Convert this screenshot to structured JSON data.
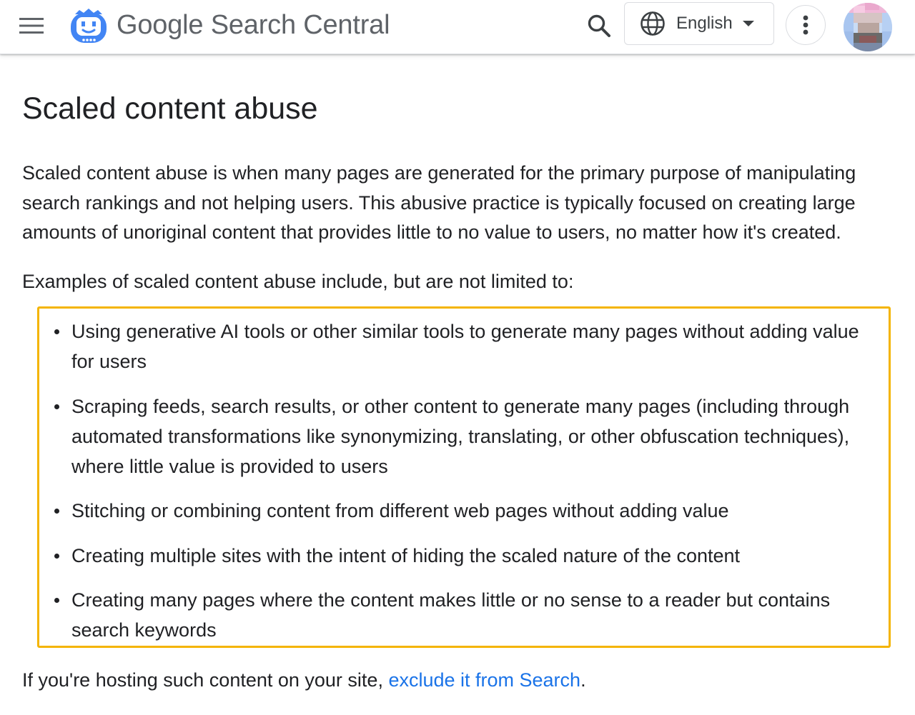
{
  "header": {
    "brand_google": "Google",
    "brand_rest": " Search Central",
    "language_label": "English",
    "icons": {
      "menu": "hamburger-menu-icon",
      "logo": "search-central-robot-logo",
      "search": "search-icon",
      "language": "globe-icon",
      "caret": "caret-down-icon",
      "more": "more-vert-icon",
      "avatar": "user-avatar"
    },
    "colors": {
      "logo_blue": "#4285f4",
      "brand_text": "#5f6368"
    }
  },
  "article": {
    "title": "Scaled content abuse",
    "intro": "Scaled content abuse is when many pages are generated for the primary purpose of manipulating search rankings and not helping users. This abusive practice is typically focused on creating large amounts of unoriginal content that provides little to no value to users, no matter how it's created.",
    "examples_intro": "Examples of scaled content abuse include, but are not limited to:",
    "examples": [
      "Using generative AI tools or other similar tools to generate many pages without adding value for users",
      "Scraping feeds, search results, or other content to generate many pages (including through automated transformations like synonymizing, translating, or other obfuscation techniques), where little value is provided to users",
      "Stitching or combining content from different web pages without adding value",
      "Creating multiple sites with the intent of hiding the scaled nature of the content",
      "Creating many pages where the content makes little or no sense to a reader but contains search keywords"
    ],
    "footer_prefix": "If you're hosting such content on your site, ",
    "footer_link": "exclude it from Search",
    "footer_suffix": ".",
    "colors": {
      "highlight_border": "#f4b400",
      "link": "#1a73e8"
    }
  }
}
